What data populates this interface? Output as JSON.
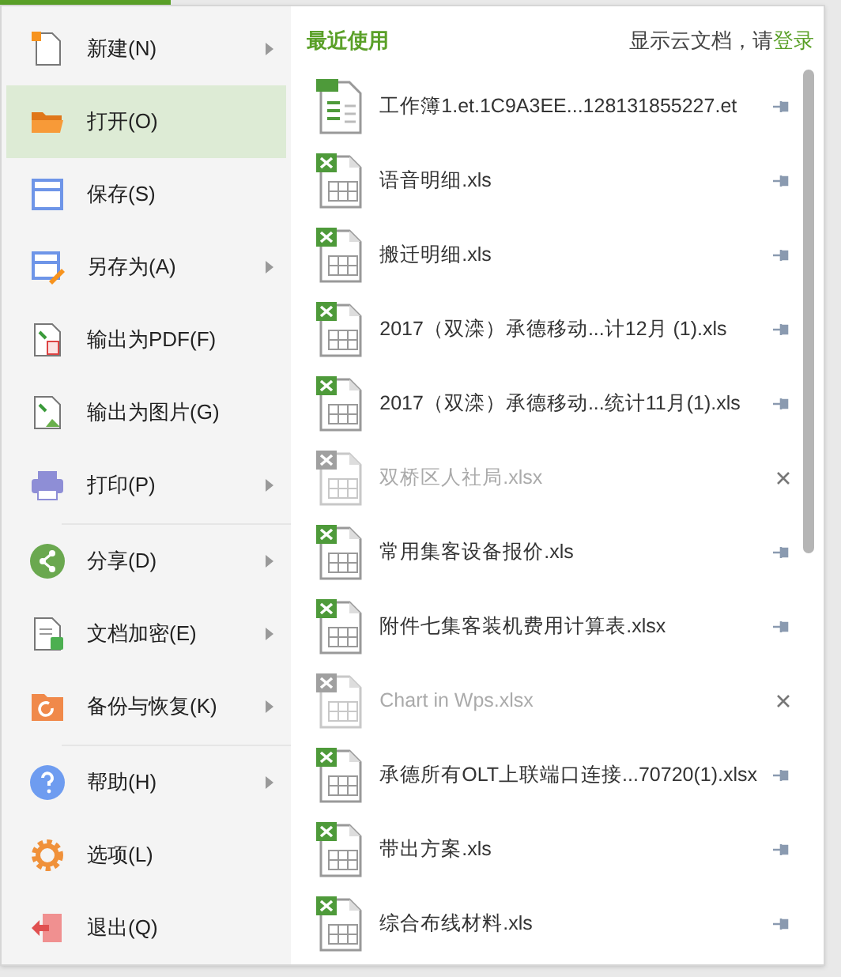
{
  "menu_groups": [
    [
      {
        "kind": "new",
        "label": "新建(N)",
        "has_submenu": true,
        "selected": false
      },
      {
        "kind": "open",
        "label": "打开(O)",
        "has_submenu": false,
        "selected": true
      },
      {
        "kind": "save",
        "label": "保存(S)",
        "has_submenu": false,
        "selected": false
      },
      {
        "kind": "saveas",
        "label": "另存为(A)",
        "has_submenu": true,
        "selected": false
      },
      {
        "kind": "pdf",
        "label": "输出为PDF(F)",
        "has_submenu": false,
        "selected": false
      },
      {
        "kind": "image",
        "label": "输出为图片(G)",
        "has_submenu": false,
        "selected": false
      },
      {
        "kind": "print",
        "label": "打印(P)",
        "has_submenu": true,
        "selected": false
      }
    ],
    [
      {
        "kind": "share",
        "label": "分享(D)",
        "has_submenu": true,
        "selected": false
      },
      {
        "kind": "encrypt",
        "label": "文档加密(E)",
        "has_submenu": true,
        "selected": false
      },
      {
        "kind": "backup",
        "label": "备份与恢复(K)",
        "has_submenu": true,
        "selected": false
      }
    ],
    [
      {
        "kind": "help",
        "label": "帮助(H)",
        "has_submenu": true,
        "selected": false
      },
      {
        "kind": "options",
        "label": "选项(L)",
        "has_submenu": false,
        "selected": false
      },
      {
        "kind": "exit",
        "label": "退出(Q)",
        "has_submenu": false,
        "selected": false
      }
    ]
  ],
  "recent": {
    "title": "最近使用",
    "cloud_prompt": "显示云文档，请",
    "login_link": "登录",
    "files": [
      {
        "kind": "et",
        "name": "工作簿1.et.1C9A3EE...128131855227.et",
        "missing": false
      },
      {
        "kind": "xls",
        "name": "语音明细.xls",
        "missing": false
      },
      {
        "kind": "xls",
        "name": "搬迁明细.xls",
        "missing": false
      },
      {
        "kind": "xls",
        "name": "2017（双滦）承德移动...计12月 (1).xls",
        "missing": false
      },
      {
        "kind": "xls",
        "name": "2017（双滦）承德移动...统计11月(1).xls",
        "missing": false
      },
      {
        "kind": "xls",
        "name": "双桥区人社局.xlsx",
        "missing": true
      },
      {
        "kind": "xls",
        "name": "常用集客设备报价.xls",
        "missing": false
      },
      {
        "kind": "xls",
        "name": "附件七集客装机费用计算表.xlsx",
        "missing": false
      },
      {
        "kind": "xls",
        "name": "Chart in Wps.xlsx",
        "missing": true
      },
      {
        "kind": "xls",
        "name": "承德所有OLT上联端口连接...70720(1).xlsx",
        "missing": false
      },
      {
        "kind": "xls",
        "name": "带出方案.xls",
        "missing": false
      },
      {
        "kind": "xls",
        "name": "综合布线材料.xls",
        "missing": false
      }
    ]
  }
}
